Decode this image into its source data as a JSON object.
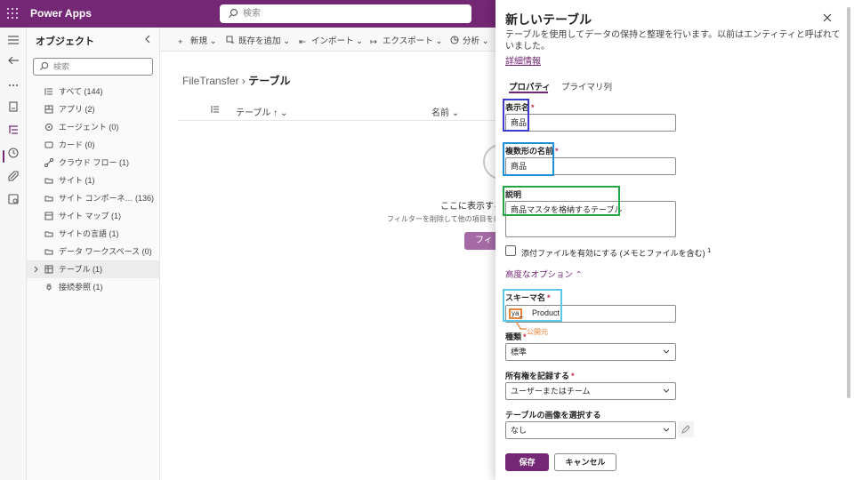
{
  "app": {
    "title": "Power Apps",
    "search_placeholder": "検索"
  },
  "objects": {
    "title": "オブジェクト",
    "search_placeholder": "検索",
    "items": [
      {
        "label": "すべて (144)"
      },
      {
        "label": "アプリ (2)"
      },
      {
        "label": "エージェント (0)"
      },
      {
        "label": "カード (0)"
      },
      {
        "label": "クラウド フロー (1)"
      },
      {
        "label": "サイト (1)"
      },
      {
        "label": "サイト コンポーネ… (136)"
      },
      {
        "label": "サイト マップ (1)"
      },
      {
        "label": "サイトの言語 (1)"
      },
      {
        "label": "データ ワークスペース (0)"
      },
      {
        "label": "テーブル (1)"
      },
      {
        "label": "接続参照 (1)"
      }
    ]
  },
  "commands": {
    "new": "新規",
    "add_existing": "既存を追加",
    "import": "インポート",
    "export": "エクスポート",
    "analyze": "分析"
  },
  "breadcrumb": {
    "parent": "FileTransfer",
    "current": "テーブル"
  },
  "grid": {
    "col_table": "テーブル ↑",
    "col_name": "名前"
  },
  "empty": {
    "title": "ここに表示する",
    "subtitle": "フィルターを削除して他の項目を表",
    "button": "フィル"
  },
  "panel": {
    "title": "新しいテーブル",
    "description": "テーブルを使用してデータの保持と整理を行います。以前はエンティティと呼ばれていました。",
    "learn_more": "詳細情報",
    "tabs": {
      "properties": "プロパティ",
      "primary_column": "プライマリ列"
    },
    "display_name": {
      "label": "表示名",
      "value": "商品"
    },
    "plural_name": {
      "label": "複数形の名前",
      "value": "商品"
    },
    "description_field": {
      "label": "説明",
      "value": "商品マスタを格納するテーブル"
    },
    "attachments_label": "添付ファイルを有効にする (メモとファイルを含む)",
    "attachments_sup": "1",
    "advanced_label": "高度なオプション",
    "schema_name": {
      "label": "スキーマ名",
      "prefix": "ya_",
      "value": "Product",
      "publisher_note": "公開元"
    },
    "type": {
      "label": "種類",
      "value": "標準"
    },
    "ownership": {
      "label": "所有権を記録する",
      "value": "ユーザーまたはチーム"
    },
    "image": {
      "label": "テーブルの画像を選択する",
      "value": "なし"
    },
    "required_mark": "*",
    "save": "保存",
    "cancel": "キャンセル"
  },
  "colors": {
    "brand": "#742774",
    "highlight_display": "#3b3bc8",
    "highlight_plural": "#1e90d6",
    "highlight_desc": "#22a546",
    "highlight_schema": "#5ac8e8",
    "highlight_prefix": "#e8853a"
  }
}
